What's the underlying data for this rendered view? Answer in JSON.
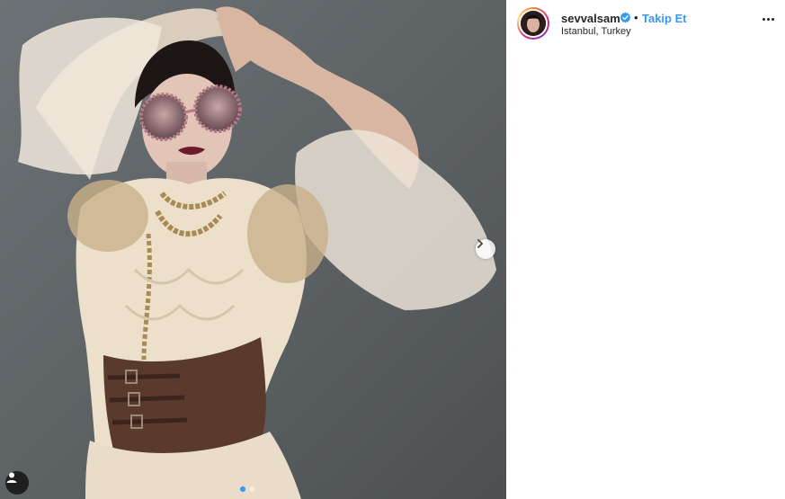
{
  "post": {
    "username": "sevvalsam",
    "verified_icon": "verified-badge-icon",
    "separator": "•",
    "follow_label": "Takip Et",
    "location": "Istanbul, Turkey",
    "more_icon": "more-options-icon"
  },
  "carousel": {
    "next_icon": "chevron-right-icon",
    "tag_icon": "user-tag-icon",
    "slide_count": 2,
    "active_slide": 1
  },
  "colors": {
    "accent": "#3897f0",
    "text": "#262626",
    "photo_background": "#5f6467"
  }
}
